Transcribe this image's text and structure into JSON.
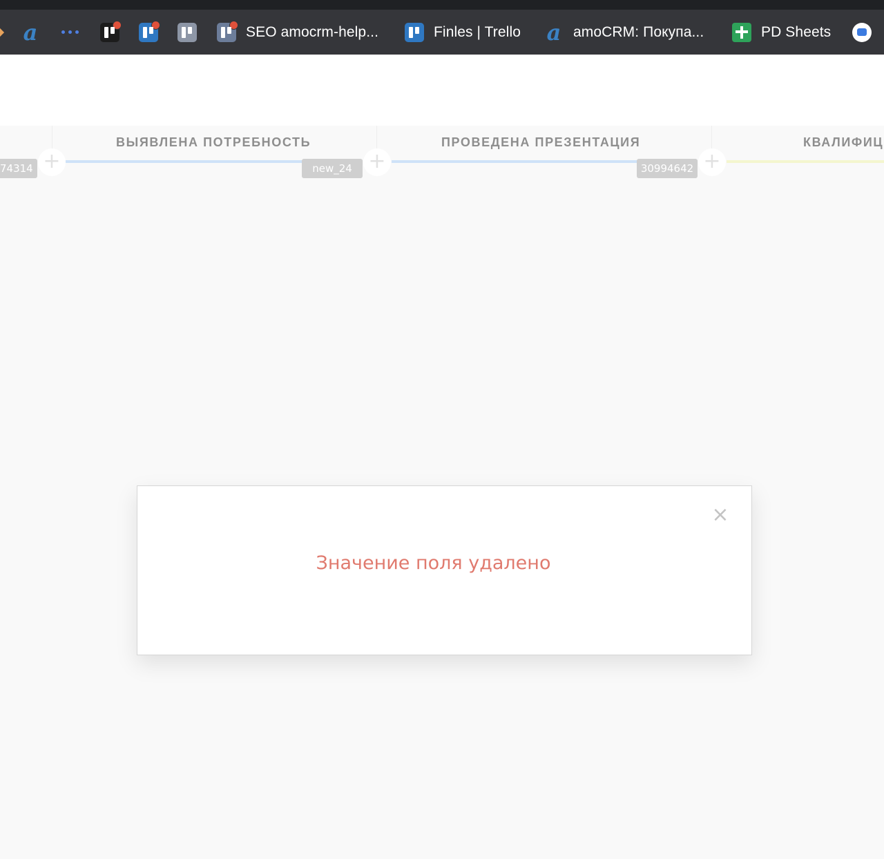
{
  "colors": {
    "bookmark_bar": "#35363a",
    "top_strip": "#1f2124",
    "page_bg": "#f9f9f9",
    "stage_title": "#8e8e8e",
    "stage_line_blue": "#cfe2f8",
    "stage_line_yellow": "#f4f6cf",
    "modal_message": "#e07a6e",
    "close_icon": "#c3c3c3",
    "pill_bg": "#cfcfcf"
  },
  "bookmarks": [
    {
      "icon": "amocrm-icon",
      "label": ""
    },
    {
      "icon": "dots-icon",
      "label": ""
    },
    {
      "icon": "trello-icon",
      "label": ""
    },
    {
      "icon": "trello-icon",
      "label": ""
    },
    {
      "icon": "trello-icon",
      "label": ""
    },
    {
      "icon": "trello-icon",
      "label": "SEO amocrm-help..."
    },
    {
      "icon": "trello-icon",
      "label": "Finles | Trello"
    },
    {
      "icon": "amocrm-icon",
      "label": "amoCRM: Покупа..."
    },
    {
      "icon": "sheets-icon",
      "label": "PD Sheets"
    },
    {
      "icon": "messages-icon",
      "label": ""
    }
  ],
  "pipeline": {
    "stages": [
      {
        "title": "Выявлена потребность",
        "start_pill": "74314",
        "end_pill": "new_24"
      },
      {
        "title": "Проведена презентация",
        "end_pill": "30994642"
      },
      {
        "title": "Квалифиц"
      }
    ],
    "add_icon": "plus-icon",
    "add_glyph": "+"
  },
  "modal": {
    "message": "Значение поля удалено",
    "close_glyph": "×",
    "close_icon": "close-icon"
  }
}
